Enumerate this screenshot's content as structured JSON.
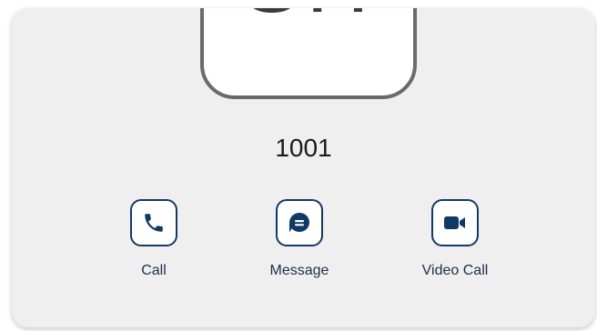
{
  "contact": {
    "avatar_initials": "SH",
    "name": "1001"
  },
  "actions": [
    {
      "label": "Call",
      "icon": "phone-icon"
    },
    {
      "label": "Message",
      "icon": "message-bubble-icon"
    },
    {
      "label": "Video Call",
      "icon": "video-camera-icon"
    }
  ],
  "colors": {
    "accent": "#0f3a66",
    "card_background": "#efefef",
    "avatar_border": "#6a6a6a"
  }
}
